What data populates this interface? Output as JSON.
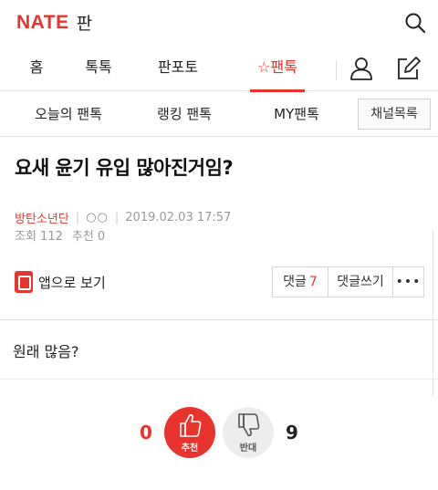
{
  "header": {
    "brand": "NATE",
    "service": "판",
    "search_icon": "search-icon"
  },
  "gnb": {
    "items": [
      {
        "label": "홈"
      },
      {
        "label": "톡톡"
      },
      {
        "label": "판포토"
      },
      {
        "label": "팬톡",
        "icon": "star-outline-icon",
        "active": true
      }
    ],
    "profile_icon": "person-icon",
    "write_icon": "write-icon"
  },
  "subnav": {
    "items": [
      {
        "label": "오늘의 팬톡"
      },
      {
        "label": "랭킹 팬톡"
      },
      {
        "label": "MY팬톡"
      }
    ],
    "channel_button": "채널목록"
  },
  "post": {
    "title": "요새 윤기 유입 많아진거임?",
    "author": "방탄소년단",
    "author_mark": "○○",
    "date": "2019.02.03 17:57",
    "views": "조회 112",
    "recommend": "추천 0",
    "body": "원래 많음?"
  },
  "actions": {
    "app_view": "앱으로 보기",
    "reply_label": "댓글",
    "reply_count": "7",
    "reply_write": "댓글쓰기",
    "more": "•••"
  },
  "votes": {
    "up_count": "0",
    "up_label": "추천",
    "down_count": "9",
    "down_label": "반대"
  },
  "colors": {
    "accent": "#e8342c",
    "text": "#222222",
    "muted": "#999999"
  }
}
